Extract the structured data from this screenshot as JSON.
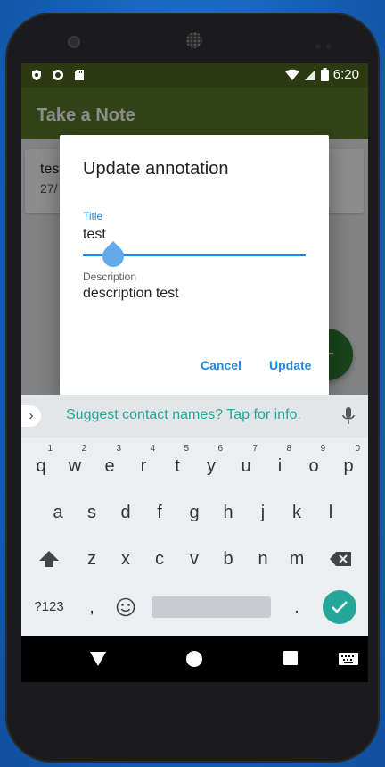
{
  "status_bar": {
    "time": "6:20"
  },
  "app": {
    "title": "Take a Note",
    "list_item": {
      "title": "test",
      "date": "27/"
    },
    "fab_label": "+"
  },
  "dialog": {
    "title": "Update annotation",
    "title_label": "Title",
    "title_value": "test",
    "description_label": "Description",
    "description_value": "description test",
    "cancel_label": "Cancel",
    "update_label": "Update"
  },
  "keyboard": {
    "suggestion": "Suggest contact names? Tap for info.",
    "row1": [
      {
        "k": "q",
        "n": "1"
      },
      {
        "k": "w",
        "n": "2"
      },
      {
        "k": "e",
        "n": "3"
      },
      {
        "k": "r",
        "n": "4"
      },
      {
        "k": "t",
        "n": "5"
      },
      {
        "k": "y",
        "n": "6"
      },
      {
        "k": "u",
        "n": "7"
      },
      {
        "k": "i",
        "n": "8"
      },
      {
        "k": "o",
        "n": "9"
      },
      {
        "k": "p",
        "n": "0"
      }
    ],
    "row2": [
      "a",
      "s",
      "d",
      "f",
      "g",
      "h",
      "j",
      "k",
      "l"
    ],
    "row3": [
      "z",
      "x",
      "c",
      "v",
      "b",
      "n",
      "m"
    ],
    "symbols_label": "?123",
    "comma": ",",
    "period": "."
  },
  "colors": {
    "accent": "#1e88e5",
    "appbar": "#5b7c2a",
    "fab": "#2e7d32",
    "keyboard_accent": "#26a69a"
  }
}
